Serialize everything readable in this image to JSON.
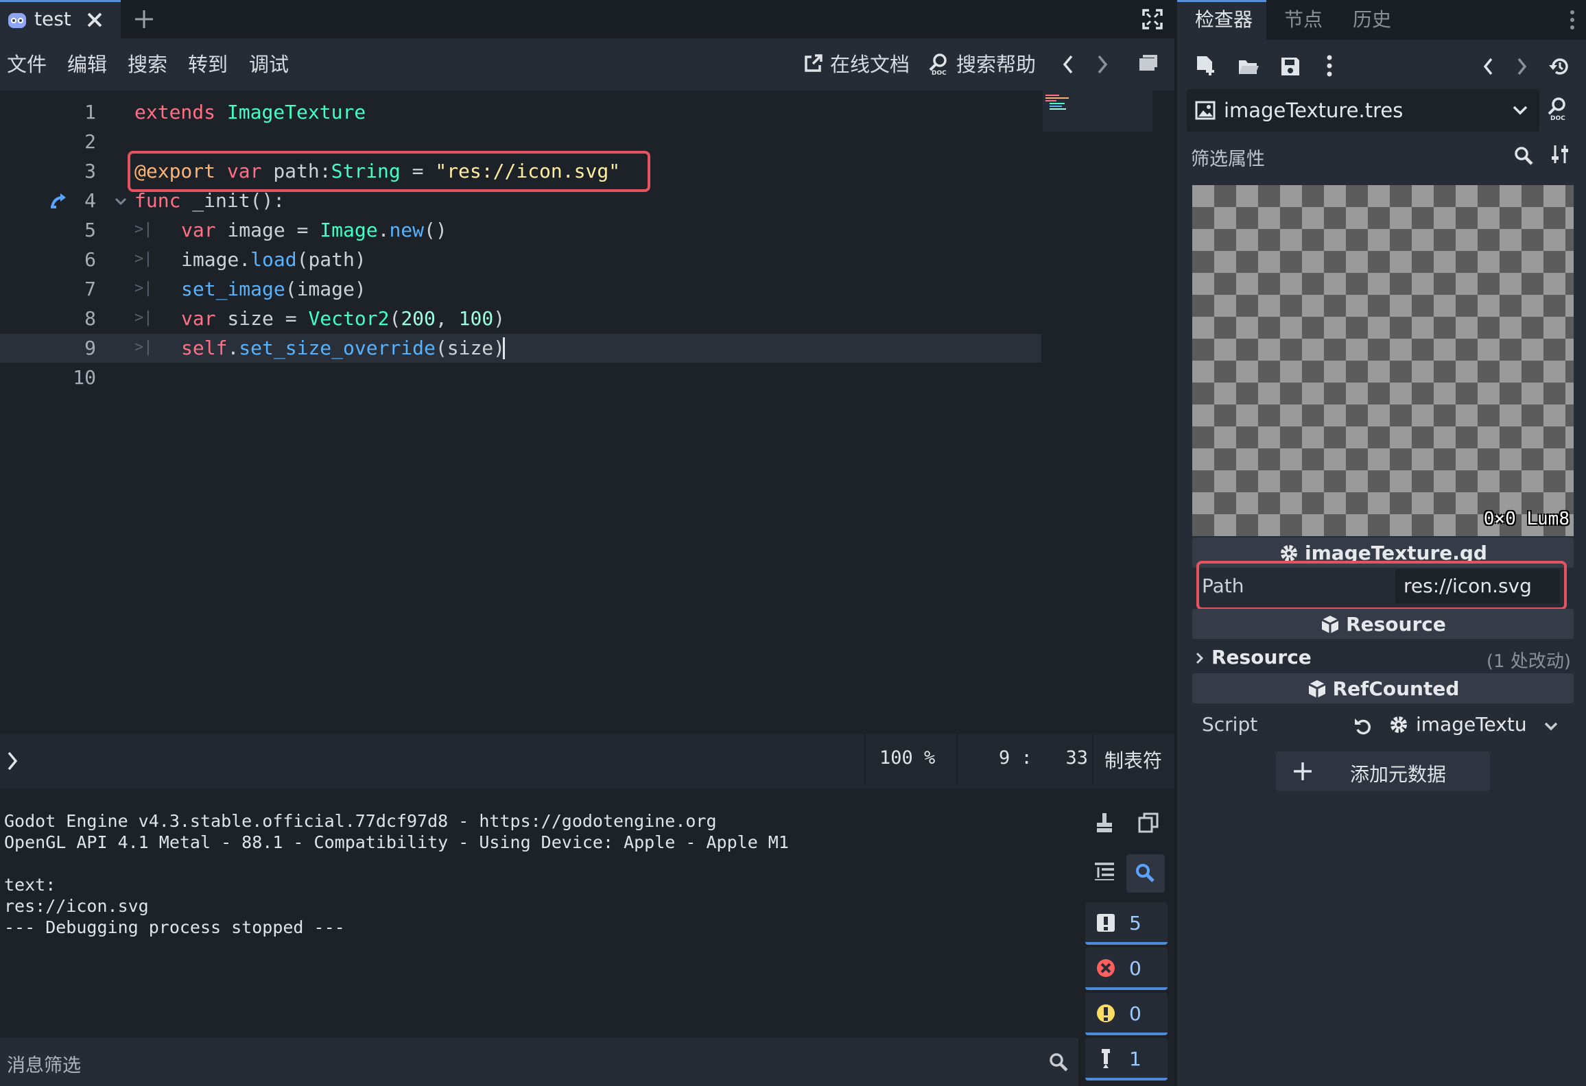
{
  "editor": {
    "tab_title": "test",
    "menu": [
      "文件",
      "编辑",
      "搜索",
      "转到",
      "调试"
    ],
    "online_docs": "在线文档",
    "search_help": "搜索帮助",
    "lines": [
      "1",
      "2",
      "3",
      "4",
      "5",
      "6",
      "7",
      "8",
      "9",
      "10"
    ],
    "code": {
      "l1_kw": "extends",
      "l1_type": "ImageTexture",
      "l3_ann": "@export",
      "l3_kw": "var",
      "l3_name": "path:",
      "l3_type": "String",
      "l3_eq": " = ",
      "l3_str": "\"res://icon.svg\"",
      "l4_kw": "func",
      "l4_rest": "_init():",
      "l5_kw": "var",
      "l5_a": " image = ",
      "l5_type": "Image",
      "l5_dot": ".",
      "l5_fn": "new",
      "l5_end": "()",
      "l6_a": "image.",
      "l6_fn": "load",
      "l6_end": "(path)",
      "l7_fn": "set_image",
      "l7_end": "(image)",
      "l8_kw": "var",
      "l8_a": " size = ",
      "l8_type": "Vector2",
      "l8_p1": "(",
      "l8_n1": "200",
      "l8_c": ", ",
      "l8_n2": "100",
      "l8_p2": ")",
      "l9_kw": "self",
      "l9_dot": ".",
      "l9_fn": "set_size_override",
      "l9_end": "(size)"
    },
    "zoom": "100 %",
    "line_col": "9 :   33",
    "indent_mode": "制表符"
  },
  "console": {
    "lines": "Godot Engine v4.3.stable.official.77dcf97d8 - https://godotengine.org\nOpenGL API 4.1 Metal - 88.1 - Compatibility - Using Device: Apple - Apple M1\n\ntext:\nres://icon.svg\n--- Debugging process stopped ---",
    "filter_placeholder": "消息筛选",
    "counts": {
      "messages": "5",
      "errors": "0",
      "warnings": "0",
      "editor": "1"
    }
  },
  "inspector": {
    "tabs": [
      "检查器",
      "节点",
      "历史"
    ],
    "resource_name": "imageTexture.tres",
    "filter_placeholder": "筛选属性",
    "preview_info": "0×0 Lum8",
    "script_section": "imageTexture.gd",
    "path_label": "Path",
    "path_value": "res://icon.svg",
    "resource_section": "Resource",
    "resource_group": "Resource",
    "resource_changes": "(1 处改动)",
    "refcounted_section": "RefCounted",
    "script_label": "Script",
    "script_value": "imageTextu",
    "add_metadata": "添加元数据"
  }
}
